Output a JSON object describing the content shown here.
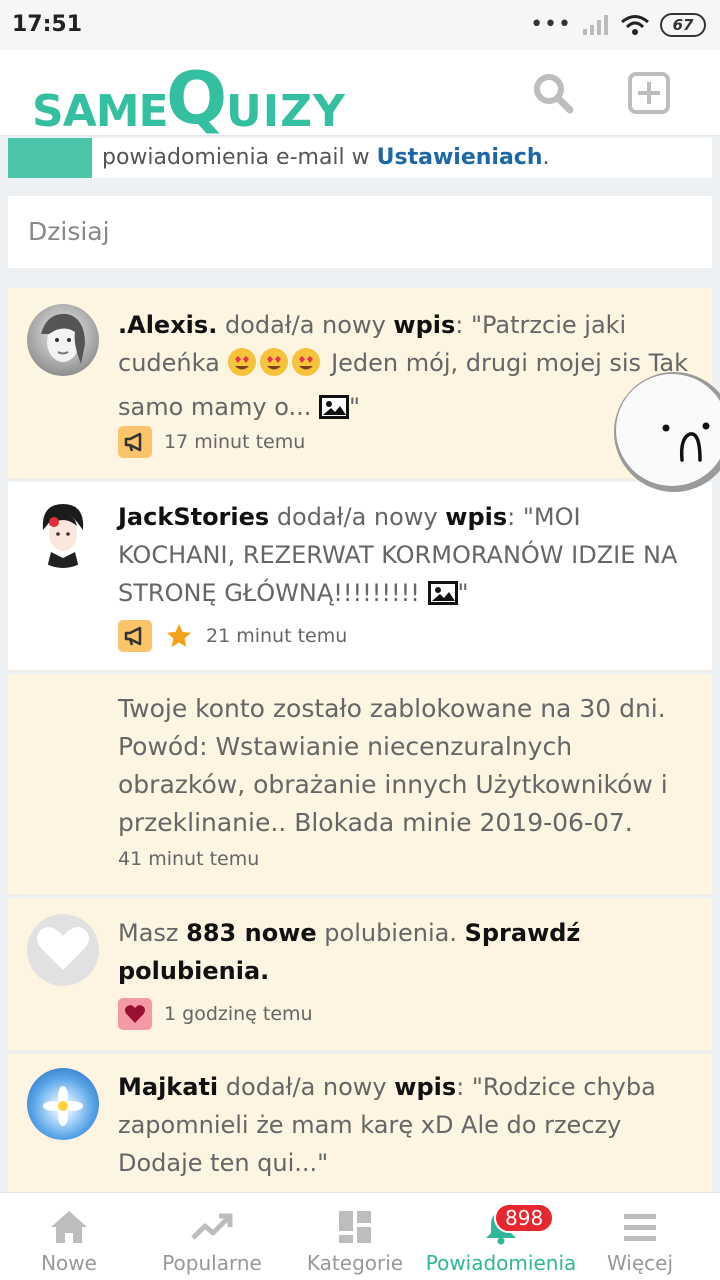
{
  "status_bar": {
    "time": "17:51",
    "battery": "67"
  },
  "header": {
    "logo": {
      "part1": "SAME",
      "part2": "Q",
      "part3": "UIZY"
    }
  },
  "email_hint": {
    "text": "powiadomienia e-mail w ",
    "link": "Ustawieniach",
    "suffix": "."
  },
  "section": {
    "title": "Dzisiaj"
  },
  "notifications": [
    {
      "user": ".Alexis.",
      "action": " dodał/a nowy ",
      "object": "wpis",
      "text_a": ": \"Patrzcie jaki cudeńka ",
      "text_b": " Jeden mój, drugi mojej sis Tak samo mamy o... ",
      "end": "\"",
      "time": "17 minut temu"
    },
    {
      "user": "JackStories",
      "action": " dodał/a nowy ",
      "object": "wpis",
      "text": ": \"MOI KOCHANI, REZERWAT KORMORANÓW IDZIE NA STRONĘ GŁÓWNĄ!!!!!!!!! ",
      "end": "\"",
      "time": "21 minut temu"
    },
    {
      "text": "Twoje konto zostało zablokowane na 30 dni. Powód: Wstawianie niecenzuralnych obrazków, obrażanie innych Użytkowników i przeklinanie.. Blokada minie 2019-06-07.",
      "time": "41 minut temu"
    },
    {
      "prefix": "Masz ",
      "count": "883 nowe",
      "middle": " polubienia. ",
      "link": "Sprawdź polubienia.",
      "time": "1 godzinę temu"
    },
    {
      "user": "Majkati",
      "action": " dodał/a nowy ",
      "object": "wpis",
      "text": ": \"Rodzice chyba zapomnieli że mam karę xD Ale do rzeczy Dodaje ten qui...\""
    }
  ],
  "nav": {
    "items": [
      "Nowe",
      "Popularne",
      "Kategorie",
      "Powiadomienia",
      "Więcej"
    ],
    "badge": "898",
    "active": "Powiadomienia"
  },
  "colors": {
    "brand": "#33bfa0",
    "active_tab": "#2fb79a",
    "notif_bg": "#fdf4e2",
    "link": "#1c67a8",
    "badge": "#e8262e"
  }
}
